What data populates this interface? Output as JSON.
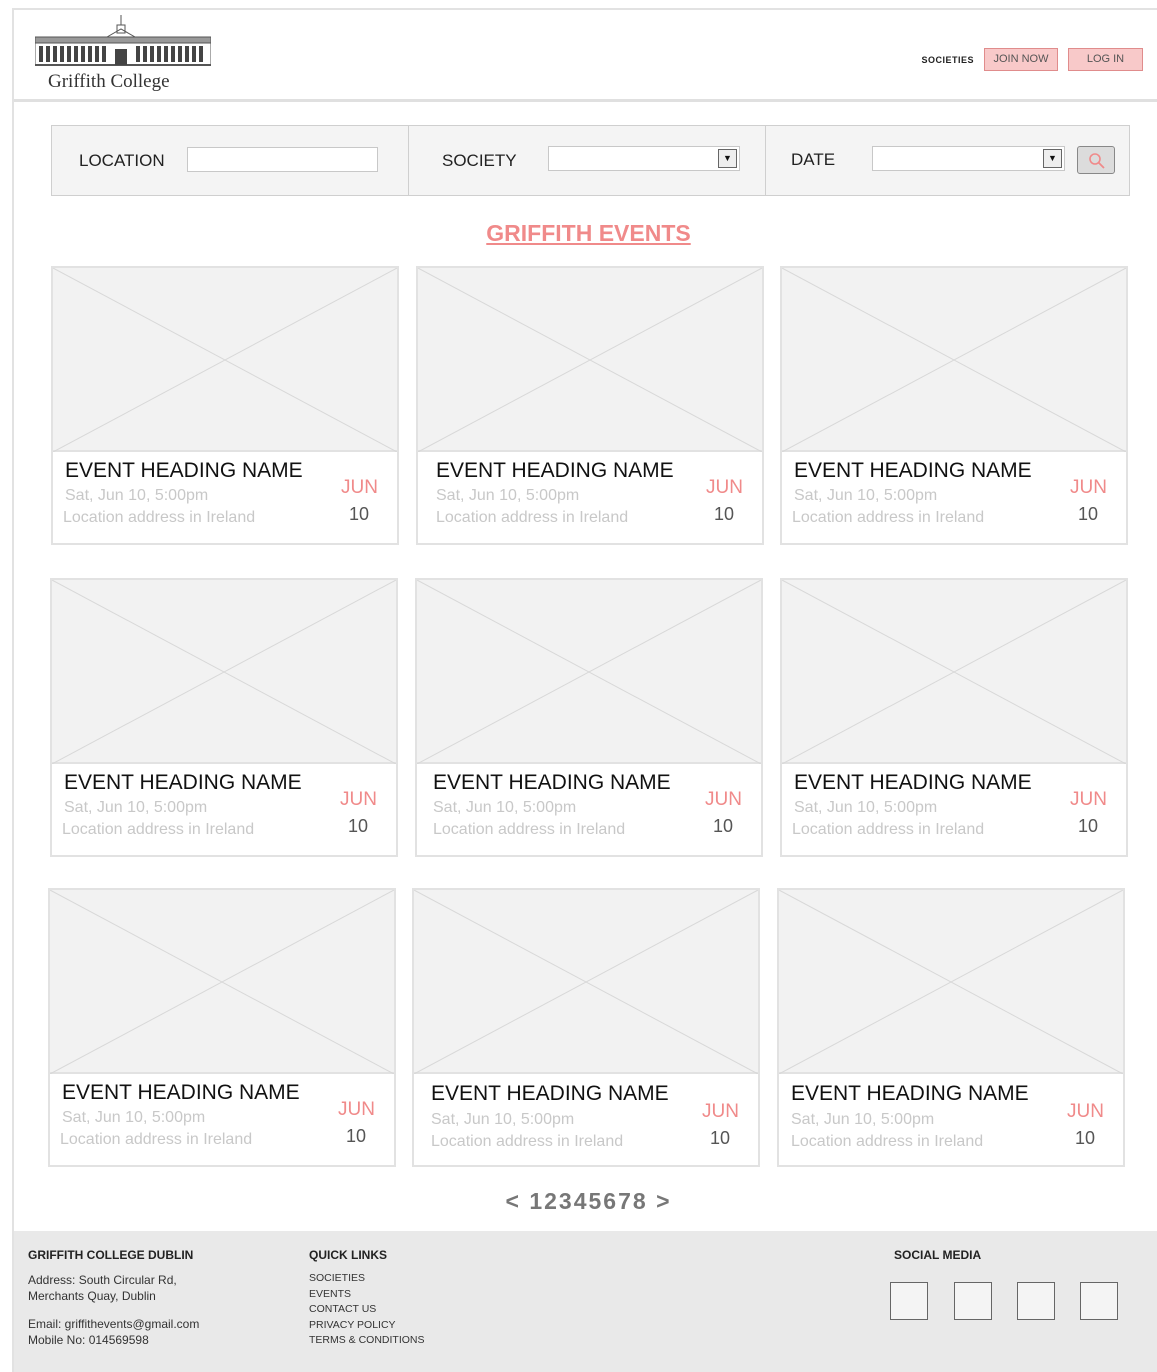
{
  "header": {
    "logo_text": "Griffith College",
    "nav": {
      "societies": "SOCIETIES",
      "join_now": "JOIN NOW",
      "log_in": "LOG IN"
    }
  },
  "search": {
    "location_label": "LOCATION",
    "location_value": "",
    "society_label": "SOCIETY",
    "society_value": "",
    "date_label": "DATE",
    "date_value": ""
  },
  "page_title": "GRIFFITH EVENTS",
  "events": [
    {
      "heading": "EVENT HEADING NAME",
      "datetime": "Sat, Jun 10, 5:00pm",
      "location": "Location address in Ireland",
      "month": "JUN",
      "day": "10"
    },
    {
      "heading": "EVENT HEADING NAME",
      "datetime": "Sat, Jun 10, 5:00pm",
      "location": "Location address in Ireland",
      "month": "JUN",
      "day": "10"
    },
    {
      "heading": "EVENT HEADING NAME",
      "datetime": "Sat, Jun 10, 5:00pm",
      "location": "Location address in Ireland",
      "month": "JUN",
      "day": "10"
    },
    {
      "heading": "EVENT HEADING NAME",
      "datetime": "Sat, Jun 10, 5:00pm",
      "location": "Location address in Ireland",
      "month": "JUN",
      "day": "10"
    },
    {
      "heading": "EVENT HEADING NAME",
      "datetime": "Sat, Jun 10, 5:00pm",
      "location": "Location address in Ireland",
      "month": "JUN",
      "day": "10"
    },
    {
      "heading": "EVENT HEADING NAME",
      "datetime": "Sat, Jun 10, 5:00pm",
      "location": "Location address in Ireland",
      "month": "JUN",
      "day": "10"
    },
    {
      "heading": "EVENT HEADING NAME",
      "datetime": "Sat, Jun 10, 5:00pm",
      "location": "Location address in Ireland",
      "month": "JUN",
      "day": "10"
    },
    {
      "heading": "EVENT HEADING NAME",
      "datetime": "Sat, Jun 10, 5:00pm",
      "location": "Location address in Ireland",
      "month": "JUN",
      "day": "10"
    },
    {
      "heading": "EVENT HEADING NAME",
      "datetime": "Sat, Jun 10, 5:00pm",
      "location": "Location address in Ireland",
      "month": "JUN",
      "day": "10"
    }
  ],
  "pagination": {
    "prev": "<",
    "pages": [
      "1",
      "2",
      "3",
      "4",
      "5",
      "6",
      "7",
      "8"
    ],
    "next": ">"
  },
  "footer": {
    "college": {
      "heading": "GRIFFITH COLLEGE DUBLIN",
      "address_line1": "Address: South Circular Rd,",
      "address_line2": "Merchants Quay, Dublin",
      "email": "Email: griffithevents@gmail.com",
      "mobile": "Mobile No: 014569598"
    },
    "quick_links": {
      "heading": "QUICK LINKS",
      "items": [
        "SOCIETIES",
        "EVENTS",
        "CONTACT US",
        "PRIVACY POLICY",
        "TERMS & CONDITIONS"
      ]
    },
    "social": {
      "heading": "SOCIAL MEDIA",
      "icons": [
        "social-icon-1",
        "social-icon-2",
        "social-icon-3",
        "social-icon-4"
      ]
    }
  },
  "colors": {
    "accent": "#f08a8a",
    "button_fill": "#f8c9c9",
    "footer_bg": "#e9e9e9"
  }
}
